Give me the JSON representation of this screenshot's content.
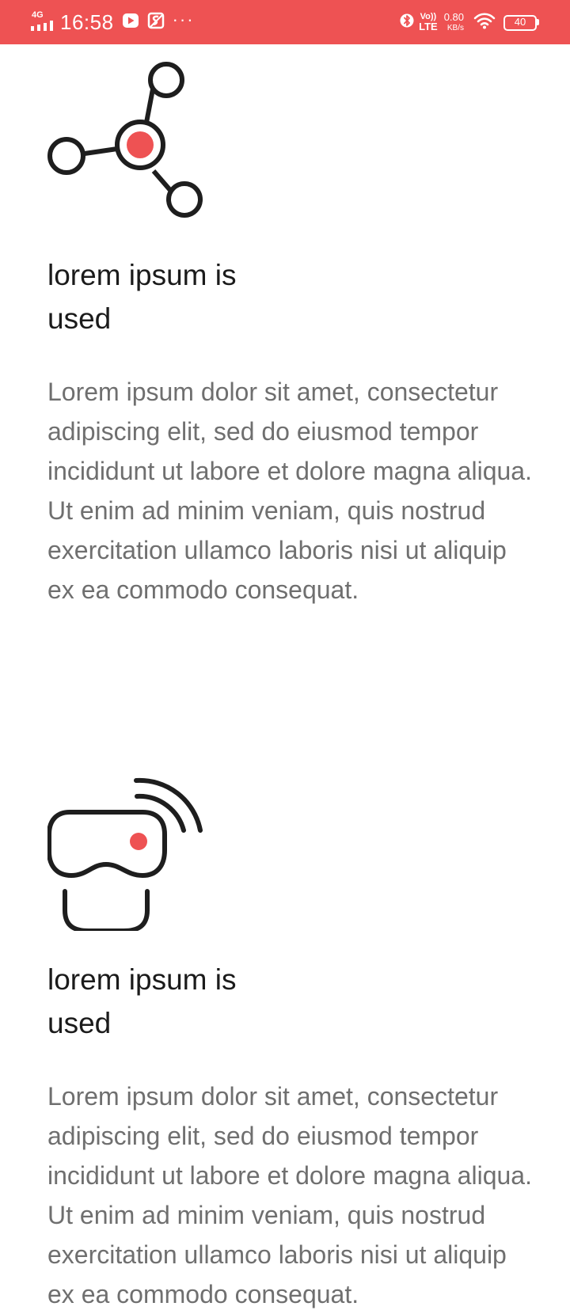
{
  "status_bar": {
    "network": "4G",
    "time": "16:58",
    "volte_top": "Vo))",
    "volte_bottom": "LTE",
    "speed_value": "0.80",
    "speed_unit": "KB/s",
    "battery": "40",
    "more": "···",
    "background_color": "#ee5253"
  },
  "features": [
    {
      "icon": "network-nodes-icon",
      "title": "lorem ipsum is used",
      "description": "Lorem ipsum dolor sit amet, consectetur adipiscing elit, sed do eiusmod tempor incididunt ut labore et dolore magna aliqua. Ut enim ad minim veniam, quis nostrud exercitation ullamco laboris nisi ut aliquip ex ea commodo consequat."
    },
    {
      "icon": "vr-headset-icon",
      "title": "lorem ipsum is used",
      "description": "Lorem ipsum dolor sit amet, consectetur adipiscing elit, sed do eiusmod tempor incididunt ut labore et dolore magna aliqua. Ut enim ad minim veniam, quis nostrud exercitation ullamco laboris nisi ut aliquip ex ea commodo consequat."
    }
  ],
  "colors": {
    "accent": "#ee5253",
    "title_text": "#1b1b1b",
    "body_text": "#6f6f6f",
    "icon_stroke": "#1e1e1e"
  }
}
